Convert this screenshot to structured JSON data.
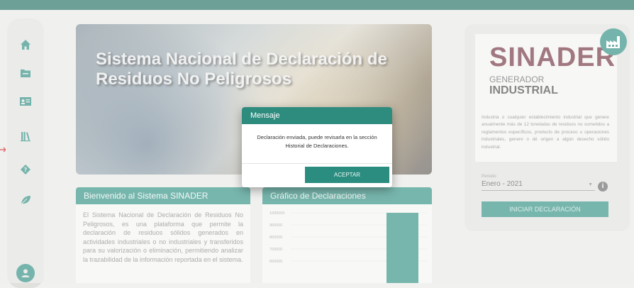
{
  "hero": {
    "title": "Sistema Nacional de Declaración de Residuos No Peligrosos"
  },
  "welcome": {
    "header": "Bienvenido al Sistema SINADER",
    "text": "El Sistema Nacional de Declaración de Residuos No Peligrosos, es una plataforma que permite la declaración de residuos sólidos generados en actividades industriales o no industriales y transferidos para su valorización o eliminación, permitiendo analizar la trazabilidad de la información reportada en el sistema."
  },
  "chart": {
    "header": "Gráfico de Declaraciones",
    "chart_data": {
      "type": "bar",
      "ytick_labels": [
        "1000000",
        "900000",
        "800000",
        "700000",
        "600000"
      ],
      "ylim": [
        550000,
        1000000
      ],
      "values": [
        1000000
      ]
    }
  },
  "right_panel": {
    "logo": "SINADER",
    "generator_line1": "GENERADOR",
    "generator_line2": "INDUSTRIAL",
    "description": "Industria o cualquier establecimiento industrial que genere anualmente más de 12 toneladas de residuos no sometidos a reglamentos específicos, producto de proceso u operaciones industriales, genere o dé origen a algún desecho sólido industrial.",
    "period_label": "Periodo",
    "period_value": "Enero - 2021",
    "start_button": "INICIAR DECLARACIÓN"
  },
  "modal": {
    "title": "Mensaje",
    "message": "Declaración enviada, puede revisarla en la sección Historial de Declaraciones.",
    "accept_button": "ACEPTAR"
  },
  "nav_icons": [
    "home-icon",
    "folder-icon",
    "id-card-icon",
    "library-icon",
    "question-diamond-icon",
    "leaf-icon",
    "user-icon"
  ],
  "colors": {
    "accent": "#2e8c7f",
    "logo": "#6f2f3d"
  }
}
